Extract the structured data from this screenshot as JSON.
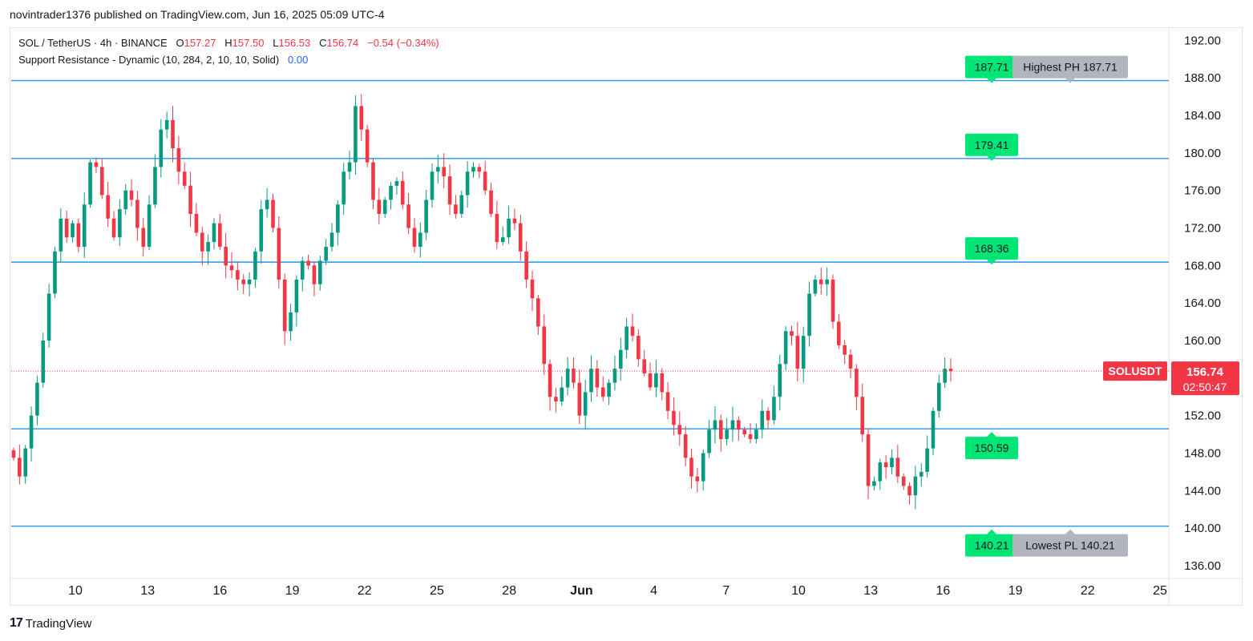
{
  "header": {
    "published": "novintrader1376 published on TradingView.com, Jun 16, 2025 05:09 UTC-4"
  },
  "legend": {
    "symbol": "SOL / TetherUS · 4h · BINANCE",
    "o_label": "O",
    "o_value": "157.27",
    "h_label": "H",
    "h_value": "157.50",
    "l_label": "L",
    "l_value": "156.53",
    "c_label": "C",
    "c_value": "156.74",
    "change": "−0.54 (−0.34%)",
    "indicator": "Support Resistance - Dynamic (10, 284, 2, 10, 10, Solid)",
    "indicator_value": "0.00"
  },
  "footer": {
    "brand": "TradingView",
    "logo": "17"
  },
  "colors": {
    "up": "#089981",
    "down": "#f23645",
    "level_line": "#2196f3",
    "level_label": "#00e676",
    "extreme_label": "#b2b5be",
    "price_tag": "#f23645"
  },
  "chart_data": {
    "type": "candlestick",
    "symbol": "SOLUSDT",
    "timeframe": "4h",
    "ylim": [
      134.8,
      193.4
    ],
    "y_ticks": [
      "192.00",
      "188.00",
      "184.00",
      "180.00",
      "176.00",
      "172.00",
      "168.00",
      "164.00",
      "160.00",
      "156.00",
      "152.00",
      "148.00",
      "144.00",
      "140.00",
      "136.00"
    ],
    "x_ticks": [
      "10",
      "13",
      "16",
      "19",
      "22",
      "25",
      "28",
      "Jun",
      "4",
      "7",
      "10",
      "13",
      "16",
      "19",
      "22",
      "25"
    ],
    "levels": [
      {
        "value": 187.71,
        "label": "187.71",
        "note": "Highest PH 187.71"
      },
      {
        "value": 179.41,
        "label": "179.41",
        "note": ""
      },
      {
        "value": 168.36,
        "label": "168.36",
        "note": ""
      },
      {
        "value": 150.59,
        "label": "150.59",
        "note": ""
      },
      {
        "value": 140.21,
        "label": "140.21",
        "note": "Lowest PL 140.21"
      }
    ],
    "last_price": {
      "value": 156.74,
      "symbol_tag": "SOLUSDT",
      "price": "156.74",
      "countdown": "02:50:47"
    },
    "path": [
      147.5,
      145.5,
      148.5,
      152.0,
      155.5,
      160.0,
      165.0,
      169.5,
      173.0,
      171.0,
      172.5,
      170.0,
      174.5,
      179.0,
      178.5,
      175.5,
      173.0,
      171.0,
      174.0,
      176.0,
      175.0,
      172.0,
      170.0,
      174.5,
      178.5,
      182.5,
      183.5,
      180.5,
      178.0,
      176.5,
      173.5,
      171.5,
      169.5,
      170.5,
      172.5,
      170.0,
      168.0,
      167.5,
      166.5,
      166.0,
      166.5,
      169.5,
      174.0,
      175.0,
      172.0,
      166.5,
      161.0,
      163.0,
      166.5,
      168.5,
      168.0,
      166.0,
      168.5,
      170.0,
      171.5,
      174.5,
      178.0,
      179.0,
      185.0,
      182.5,
      179.0,
      175.0,
      173.5,
      175.0,
      176.5,
      177.0,
      174.5,
      172.0,
      170.0,
      171.5,
      175.0,
      178.0,
      178.5,
      177.5,
      174.5,
      173.5,
      175.5,
      178.0,
      178.5,
      178.0,
      176.0,
      173.5,
      170.5,
      171.0,
      173.0,
      172.5,
      169.5,
      166.5,
      164.5,
      161.5,
      157.5,
      154.0,
      153.5,
      155.0,
      157.0,
      155.5,
      152.0,
      154.5,
      157.0,
      155.0,
      154.0,
      155.5,
      157.0,
      159.0,
      161.5,
      160.5,
      158.0,
      156.5,
      155.0,
      156.5,
      154.5,
      152.5,
      151.0,
      150.0,
      147.5,
      145.5,
      145.0,
      148.0,
      150.5,
      151.5,
      149.5,
      150.5,
      151.5,
      150.5,
      150.0,
      149.5,
      150.5,
      152.5,
      151.5,
      154.0,
      157.5,
      161.0,
      160.5,
      157.0,
      160.5,
      165.0,
      166.5,
      166.0,
      166.5,
      162.0,
      159.5,
      158.5,
      157.0,
      154.0,
      150.0,
      144.5,
      145.0,
      147.0,
      146.5,
      147.5,
      145.5,
      144.5,
      143.5,
      145.5,
      146.0,
      148.5,
      152.5,
      155.5,
      157.0,
      156.74
    ]
  }
}
